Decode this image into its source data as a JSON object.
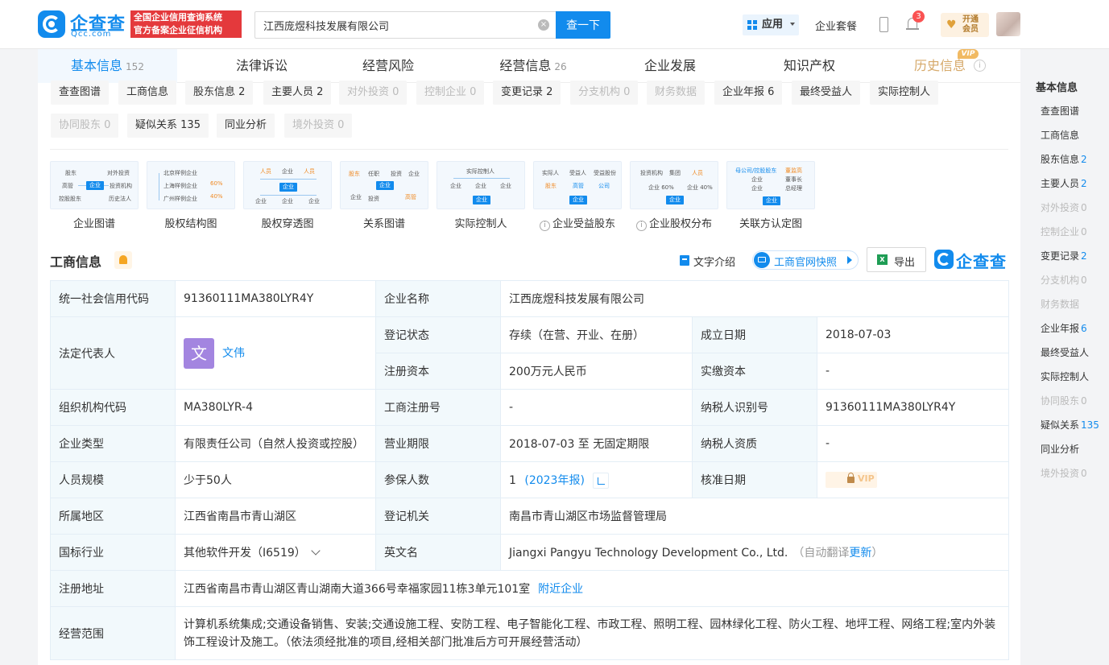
{
  "header": {
    "logo_text": "企查查",
    "logo_sub": "Qcc.com",
    "slogan_line1": "全国企业信用查询系统",
    "slogan_line2": "官方备案企业征信机构",
    "search_value": "江西庞煜科技发展有限公司",
    "search_button": "查一下",
    "app_label": "应用",
    "package_label": "企业套餐",
    "notification_count": "3",
    "vip_line1": "开通",
    "vip_line2": "会员"
  },
  "tabs": [
    {
      "label": "基本信息",
      "count": "152"
    },
    {
      "label": "法律诉讼",
      "count": ""
    },
    {
      "label": "经营风险",
      "count": ""
    },
    {
      "label": "经营信息",
      "count": "26"
    },
    {
      "label": "企业发展",
      "count": ""
    },
    {
      "label": "知识产权",
      "count": ""
    },
    {
      "label": "历史信息",
      "count": "",
      "tag": "VIP"
    }
  ],
  "subtabs": [
    {
      "label": "查查图谱",
      "count": ""
    },
    {
      "label": "工商信息",
      "count": ""
    },
    {
      "label": "股东信息",
      "count": "2"
    },
    {
      "label": "主要人员",
      "count": "2"
    },
    {
      "label": "对外投资",
      "count": "0"
    },
    {
      "label": "控制企业",
      "count": "0"
    },
    {
      "label": "变更记录",
      "count": "2"
    },
    {
      "label": "分支机构",
      "count": "0"
    },
    {
      "label": "财务数据",
      "count": ""
    },
    {
      "label": "企业年报",
      "count": "6"
    },
    {
      "label": "最终受益人",
      "count": ""
    },
    {
      "label": "实际控制人",
      "count": ""
    },
    {
      "label": "协同股东",
      "count": "0"
    },
    {
      "label": "疑似关系",
      "count": "135"
    },
    {
      "label": "同业分析",
      "count": ""
    },
    {
      "label": "境外投资",
      "count": "0"
    }
  ],
  "graphs": [
    {
      "label": "企业图谱"
    },
    {
      "label": "股权结构图"
    },
    {
      "label": "股权穿透图"
    },
    {
      "label": "关系图谱"
    },
    {
      "label": "实际控制人"
    },
    {
      "label": "企业受益股东"
    },
    {
      "label": "企业股权分布"
    },
    {
      "label": "关联方认定图"
    }
  ],
  "graph_thumbs": {
    "g1": {
      "a": "股东",
      "b": "对外投资",
      "c": "高管",
      "d": "投资机构",
      "e": "控股股东",
      "f": "历史法人",
      "hub": "企业"
    },
    "g2": {
      "a": "北京样例企业",
      "b": "上海样例企业",
      "c": "广州样例企业",
      "p1": "60%",
      "p2": "40%"
    },
    "g3": {
      "a": "人员",
      "b": "企业",
      "c": "人员",
      "hub": "企业",
      "d": "企业",
      "e": "企业",
      "f": "企业"
    },
    "g4": {
      "a": "股东",
      "b": "任职",
      "c": "投资",
      "d": "企业",
      "e": "企业",
      "f": "投资",
      "g": "高管",
      "hub": "企业"
    },
    "g5": {
      "a": "实际控制人",
      "b": "企业",
      "c": "企业",
      "d": "企业",
      "hub": "企业"
    },
    "g6": {
      "a": "实际人",
      "b": "受益人",
      "c": "受益股份",
      "d": "股东",
      "e": "高管",
      "f": "公司",
      "hub": "企业"
    },
    "g7": {
      "a": "投资机构",
      "b": "集团",
      "c": "人员",
      "d": "企业 60%",
      "e": "企业 40%",
      "hub": "企业"
    },
    "g8": {
      "a": "母公司/控股股东",
      "b": "董监高",
      "c": "企业",
      "d": "董事长",
      "e": "企业",
      "f": "总经理",
      "hub": "企业"
    }
  },
  "section": {
    "title": "工商信息",
    "text_intro": "文字介绍",
    "snapshot": "工商官网快照",
    "export": "导出",
    "brand": "企查查"
  },
  "info": {
    "credit_code_k": "统一社会信用代码",
    "credit_code_v": "91360111MA380LYR4Y",
    "name_k": "企业名称",
    "name_v": "江西庞煜科技发展有限公司",
    "legal_k": "法定代表人",
    "legal_avatar": "文",
    "legal_v": "文伟",
    "status_k": "登记状态",
    "status_v": "存续（在营、开业、在册）",
    "est_k": "成立日期",
    "est_v": "2018-07-03",
    "capital_k": "注册资本",
    "capital_v": "200万元人民币",
    "paid_k": "实缴资本",
    "paid_v": "-",
    "org_k": "组织机构代码",
    "org_v": "MA380LYR-4",
    "regno_k": "工商注册号",
    "regno_v": "-",
    "tax_k": "纳税人识别号",
    "tax_v": "91360111MA380LYR4Y",
    "type_k": "企业类型",
    "type_v": "有限责任公司（自然人投资或控股）",
    "term_k": "营业期限",
    "term_v": "2018-07-03 至 无固定期限",
    "taxq_k": "纳税人资质",
    "taxq_v": "-",
    "staff_k": "人员规模",
    "staff_v": "少于50人",
    "insured_k": "参保人数",
    "insured_v": "1",
    "insured_link": "(2023年报)",
    "approve_k": "核准日期",
    "approve_lock": "VIP",
    "region_k": "所属地区",
    "region_v": "江西省南昌市青山湖区",
    "authority_k": "登记机关",
    "authority_v": "南昌市青山湖区市场监督管理局",
    "industry_k": "国标行业",
    "industry_v": "其他软件开发（I6519）",
    "en_k": "英文名",
    "en_v": "Jiangxi Pangyu Technology Development Co., Ltd.",
    "en_note": "（自动翻译",
    "en_update": "更新",
    "en_close": "）",
    "addr_k": "注册地址",
    "addr_v": "江西省南昌市青山湖区青山湖南大道366号幸福家园11栋3单元101室",
    "addr_link": "附近企业",
    "scope_k": "经营范围",
    "scope_v": "计算机系统集成;交通设备销售、安装;交通设施工程、安防工程、电子智能化工程、市政工程、照明工程、园林绿化工程、防火工程、地坪工程、网络工程;室内外装饰工程设计及施工。（依法须经批准的项目,经相关部门批准后方可开展经营活动）"
  },
  "sidebar": {
    "title": "基本信息",
    "items": [
      {
        "label": "查查图谱",
        "count": ""
      },
      {
        "label": "工商信息",
        "count": ""
      },
      {
        "label": "股东信息",
        "count": "2"
      },
      {
        "label": "主要人员",
        "count": "2"
      },
      {
        "label": "对外投资",
        "count": "0"
      },
      {
        "label": "控制企业",
        "count": "0"
      },
      {
        "label": "变更记录",
        "count": "2"
      },
      {
        "label": "分支机构",
        "count": "0"
      },
      {
        "label": "财务数据",
        "count": ""
      },
      {
        "label": "企业年报",
        "count": "6"
      },
      {
        "label": "最终受益人",
        "count": ""
      },
      {
        "label": "实际控制人",
        "count": ""
      },
      {
        "label": "协同股东",
        "count": "0"
      },
      {
        "label": "疑似关系",
        "count": "135"
      },
      {
        "label": "同业分析",
        "count": ""
      },
      {
        "label": "境外投资",
        "count": "0"
      }
    ]
  }
}
